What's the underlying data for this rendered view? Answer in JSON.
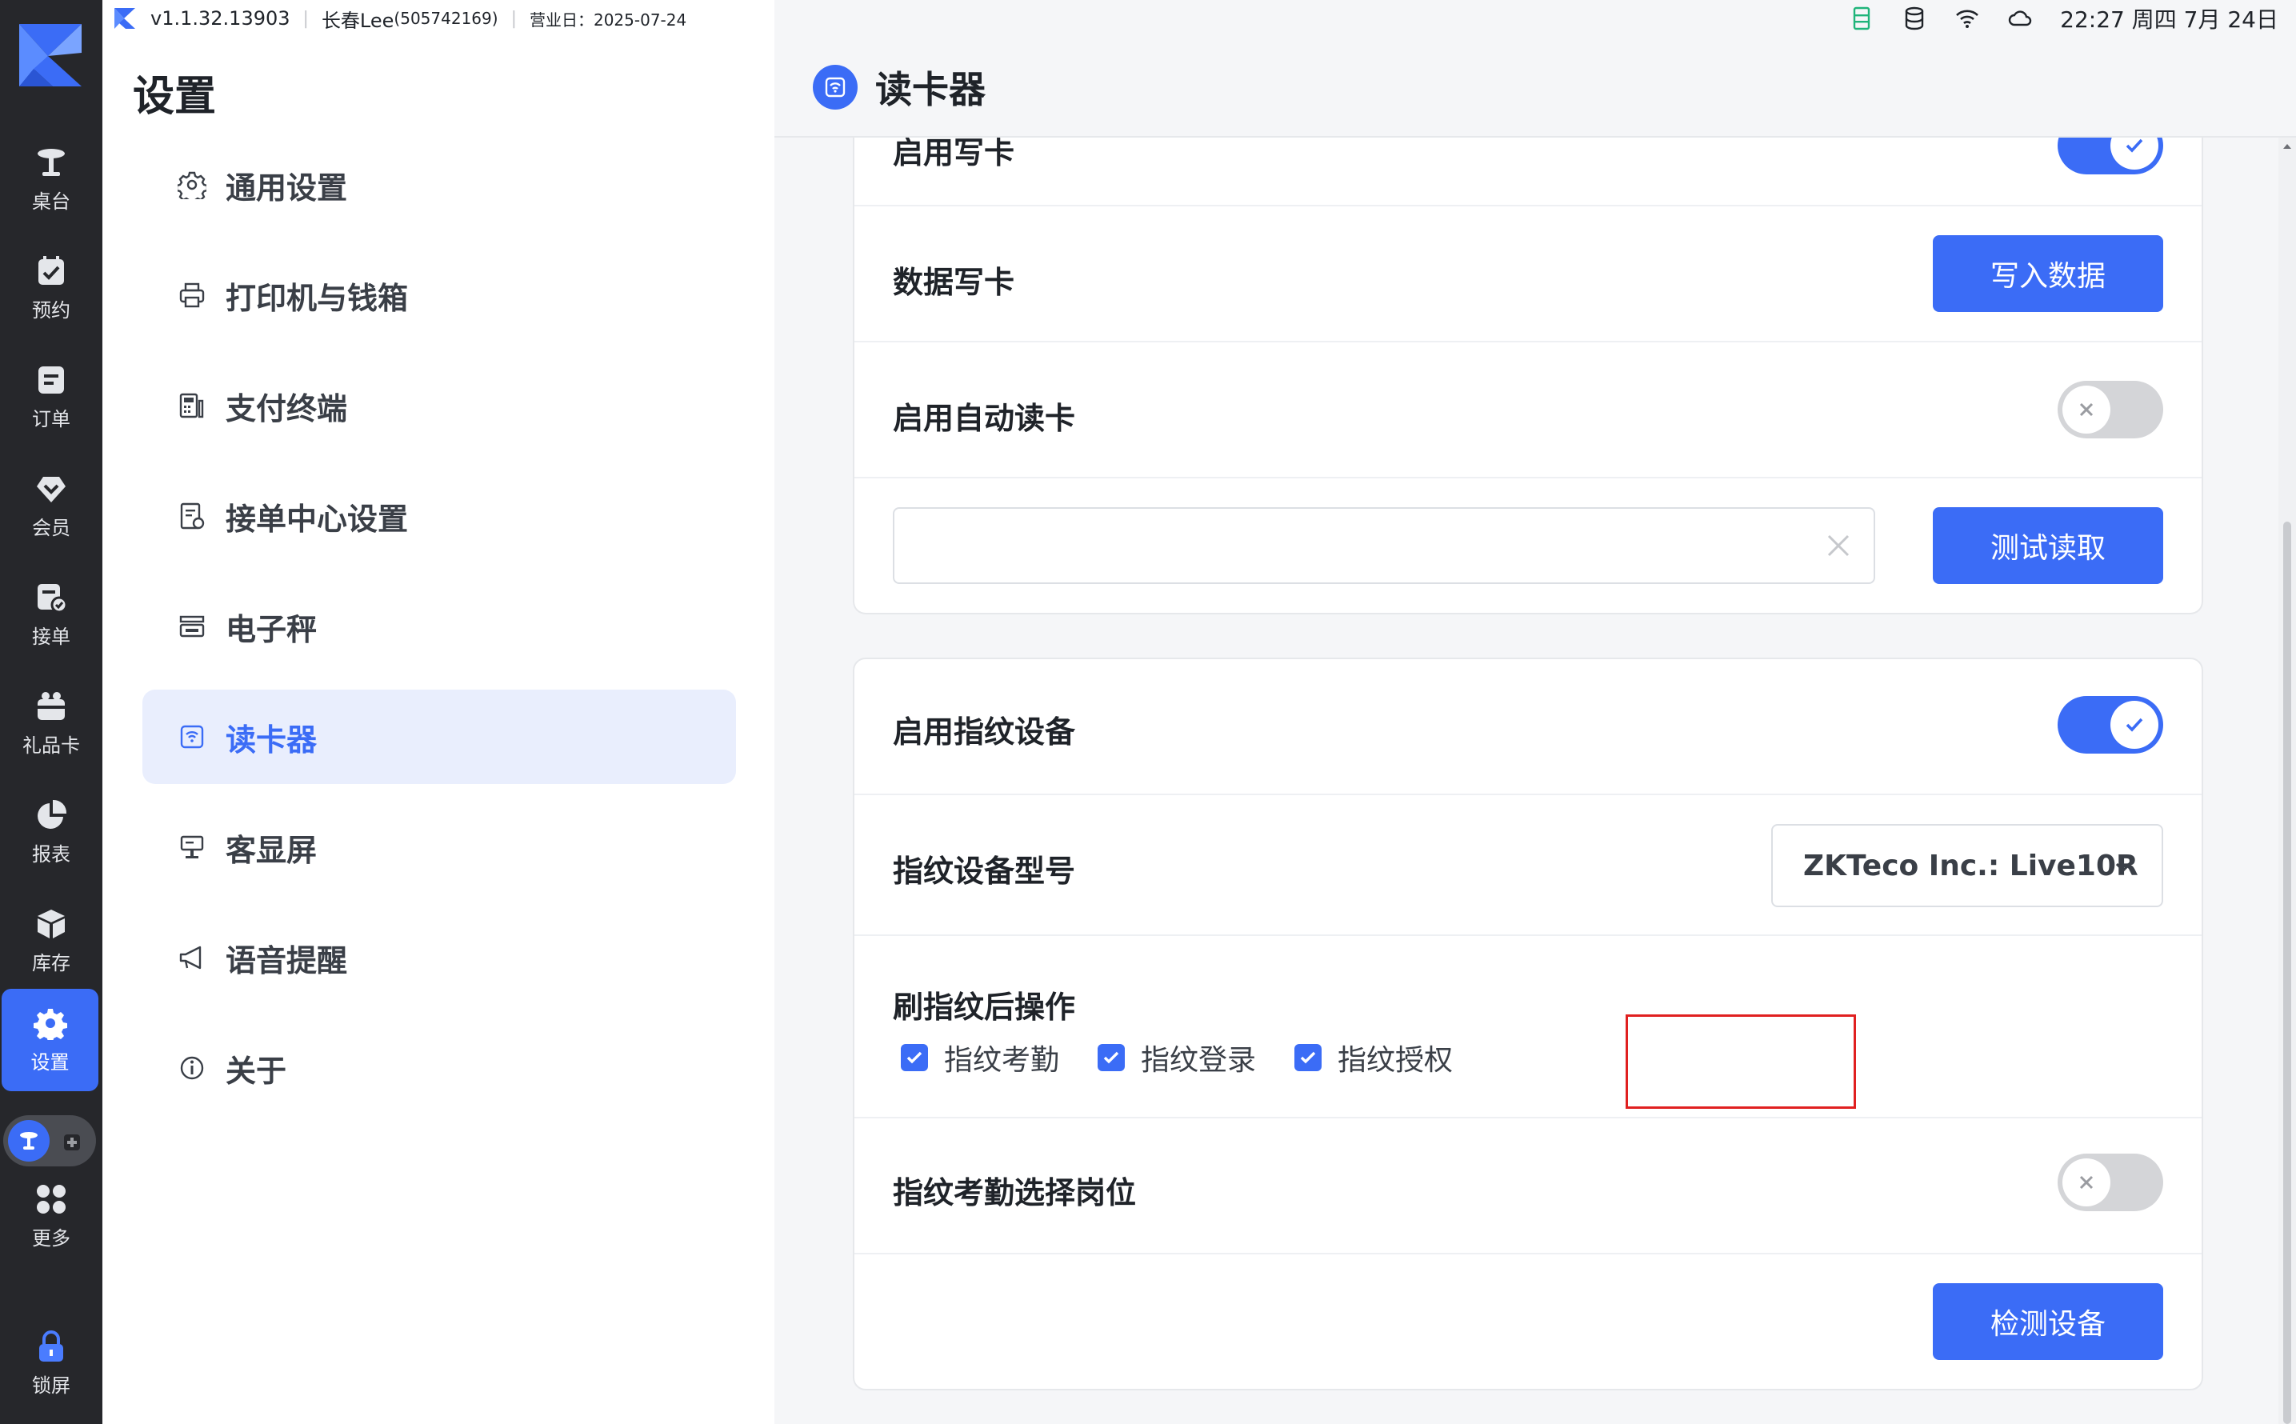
{
  "status_bar": {
    "version": "v1.1.32.13903",
    "user": "长春Lee",
    "user_id": "(505742169)",
    "business_day": "营业日：2025-07-24",
    "clock": "22:27 周四 7月 24日"
  },
  "rail": {
    "items": [
      {
        "label": "桌台",
        "icon": "table-icon"
      },
      {
        "label": "预约",
        "icon": "reservation-icon"
      },
      {
        "label": "订单",
        "icon": "order-icon"
      },
      {
        "label": "会员",
        "icon": "member-icon"
      },
      {
        "label": "接单",
        "icon": "accept-order-icon"
      },
      {
        "label": "礼品卡",
        "icon": "gift-card-icon"
      },
      {
        "label": "报表",
        "icon": "report-icon"
      },
      {
        "label": "库存",
        "icon": "inventory-icon"
      },
      {
        "label": "设置",
        "icon": "settings-icon"
      },
      {
        "label": "更多",
        "icon": "more-icon"
      },
      {
        "label": "锁屏",
        "icon": "lock-icon"
      }
    ],
    "active": "设置"
  },
  "menu": {
    "title": "设置",
    "items": [
      {
        "label": "通用设置",
        "icon": "gear-icon"
      },
      {
        "label": "打印机与钱箱",
        "icon": "printer-icon"
      },
      {
        "label": "支付终端",
        "icon": "pos-terminal-icon"
      },
      {
        "label": "接单中心设置",
        "icon": "order-center-icon"
      },
      {
        "label": "电子秤",
        "icon": "scale-icon"
      },
      {
        "label": "读卡器",
        "icon": "card-reader-icon"
      },
      {
        "label": "客显屏",
        "icon": "customer-display-icon"
      },
      {
        "label": "语音提醒",
        "icon": "megaphone-icon"
      },
      {
        "label": "关于",
        "icon": "info-icon"
      }
    ],
    "active": "读卡器"
  },
  "page": {
    "title": "读卡器",
    "card_reader": {
      "enable_write_label": "启用写卡",
      "enable_write_on": true,
      "data_write_label": "数据写卡",
      "write_button": "写入数据",
      "auto_read_label": "启用自动读卡",
      "auto_read_on": false,
      "read_input_value": "",
      "test_read_button": "测试读取"
    },
    "fingerprint": {
      "enable_label": "启用指纹设备",
      "enable_on": true,
      "model_label": "指纹设备型号",
      "model_value": "ZKTeco Inc.: Live10R",
      "after_scan_label": "刷指纹后操作",
      "options": [
        {
          "label": "指纹考勤",
          "checked": true
        },
        {
          "label": "指纹登录",
          "checked": true
        },
        {
          "label": "指纹授权",
          "checked": true
        }
      ],
      "attendance_position_label": "指纹考勤选择岗位",
      "attendance_position_on": false,
      "detect_button": "检测设备"
    }
  },
  "colors": {
    "primary": "#3b6cf6",
    "rail_bg": "#26272b",
    "active_menu_bg": "#e9eefd",
    "highlight": "#e02020"
  }
}
